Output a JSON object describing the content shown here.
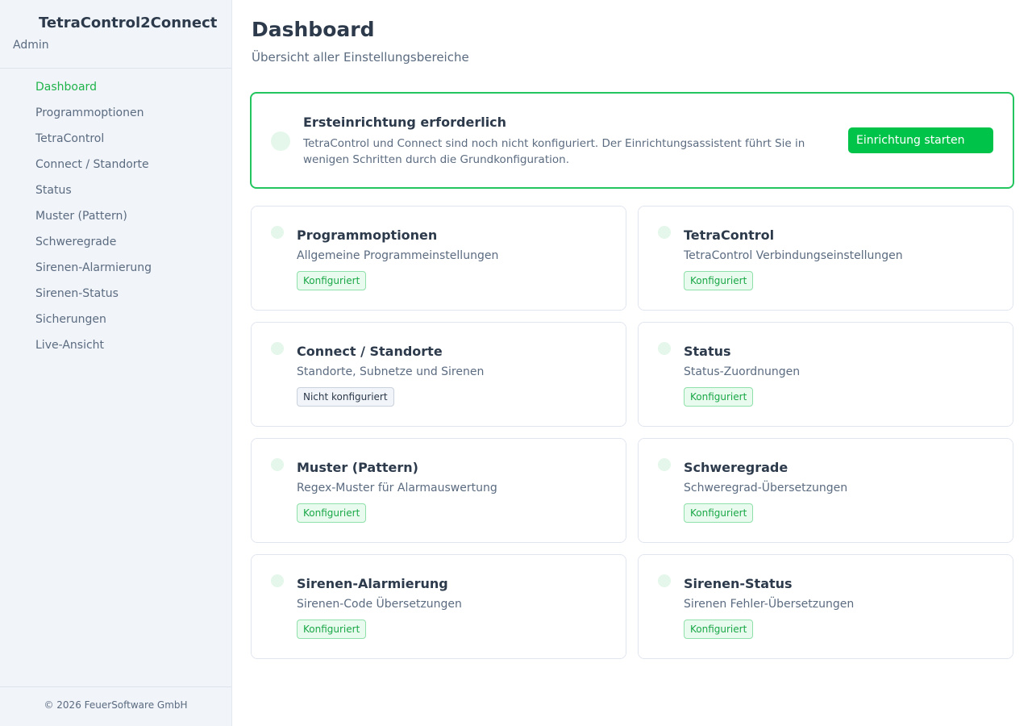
{
  "sidebar": {
    "app_title": "TetraControl2Connect",
    "role": "Admin",
    "items": [
      {
        "label": "Dashboard",
        "active": true
      },
      {
        "label": "Programmoptionen"
      },
      {
        "label": "TetraControl"
      },
      {
        "label": "Connect / Standorte"
      },
      {
        "label": "Status"
      },
      {
        "label": "Muster (Pattern)"
      },
      {
        "label": "Schweregrade"
      },
      {
        "label": "Sirenen-Alarmierung"
      },
      {
        "label": "Sirenen-Status"
      },
      {
        "label": "Sicherungen"
      },
      {
        "label": "Live-Ansicht"
      }
    ],
    "footer": "© 2026 FeuerSoftware GmbH"
  },
  "main": {
    "title": "Dashboard",
    "subtitle": "Übersicht aller Einstellungsbereiche",
    "setup": {
      "title": "Ersteinrichtung erforderlich",
      "description": "TetraControl und Connect sind noch nicht konfiguriert. Der Einrichtungsassistent führt Sie in wenigen Schritten durch die Grundkonfiguration.",
      "button_label": "Einrichtung starten"
    },
    "cards": [
      {
        "title": "Programmoptionen",
        "description": "Allgemeine Programmeinstellungen",
        "status": "Konfiguriert",
        "configured": true
      },
      {
        "title": "TetraControl",
        "description": "TetraControl Verbindungseinstellungen",
        "status": "Konfiguriert",
        "configured": true
      },
      {
        "title": "Connect / Standorte",
        "description": "Standorte, Subnetze und Sirenen",
        "status": "Nicht konfiguriert",
        "configured": false
      },
      {
        "title": "Status",
        "description": "Status-Zuordnungen",
        "status": "Konfiguriert",
        "configured": true
      },
      {
        "title": "Muster (Pattern)",
        "description": "Regex-Muster für Alarmauswertung",
        "status": "Konfiguriert",
        "configured": true
      },
      {
        "title": "Schweregrade",
        "description": "Schweregrad-Übersetzungen",
        "status": "Konfiguriert",
        "configured": true
      },
      {
        "title": "Sirenen-Alarmierung",
        "description": "Sirenen-Code Übersetzungen",
        "status": "Konfiguriert",
        "configured": true
      },
      {
        "title": "Sirenen-Status",
        "description": "Sirenen Fehler-Übersetzungen",
        "status": "Konfiguriert",
        "configured": true
      }
    ]
  },
  "colors": {
    "accent": "#22c55e",
    "button": "#00c44a",
    "sidebar_bg": "#f1f4f9",
    "badge_ok_bg": "#e9faef",
    "badge_off_bg": "#f1f4f8"
  }
}
